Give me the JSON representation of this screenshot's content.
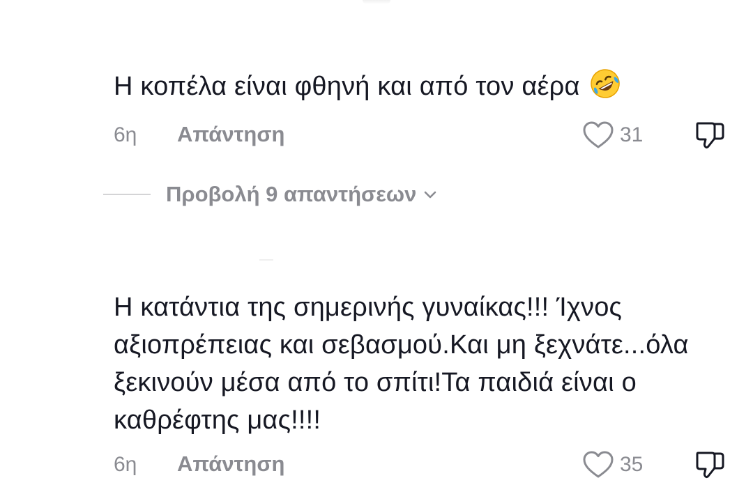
{
  "comments": [
    {
      "text": "Η κοπέλα είναι φθηνή και από τον αέρα",
      "emoji": "rolling-on-the-floor-laughing-emoji",
      "time": "6η",
      "reply_label": "Απάντηση",
      "likes": "31"
    },
    {
      "text": "Η κατάντια της σημερινής γυναίκας!!! Ίχνος αξιοπρέπειας και σεβασμού.Και μη ξεχνάτε...όλα ξεκινούν μέσα από το σπίτι!Τα παιδιά είναι ο καθρέφτης μας!!!!",
      "time": "6η",
      "reply_label": "Απάντηση",
      "likes": "35"
    }
  ],
  "view_replies": {
    "label": "Προβολή 9 απαντήσεων"
  },
  "colors": {
    "text": "#161823",
    "secondary": "#8a8b91",
    "divider": "#d4d4d6"
  }
}
